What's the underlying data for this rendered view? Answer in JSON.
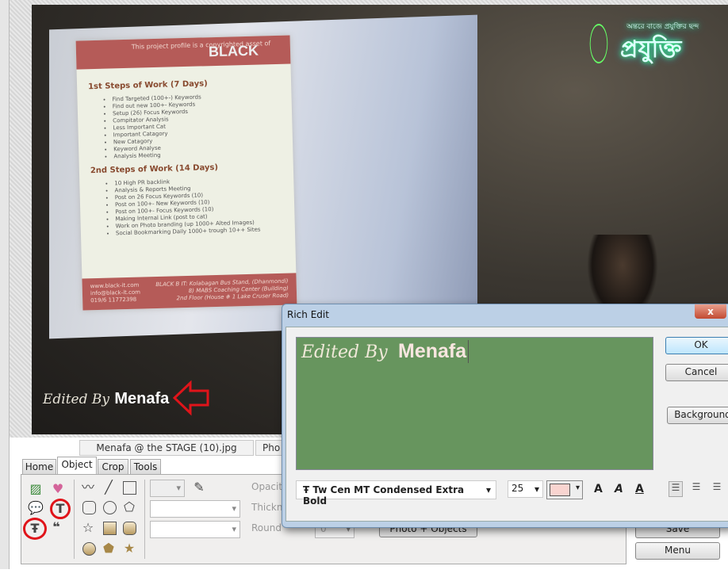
{
  "photo": {
    "slide_header": "This project profile is a copyrighted asset of",
    "slide_brand": "BLACK",
    "section1_title": "1st Steps of Work (7 Days)",
    "section1_items": [
      "Find Targeted (100+-) Keywords",
      "Find out new 100+- Keywords",
      "Setup (26) Focus Keywords",
      "Compitator Analysis",
      "Less Important Cat",
      "Important Catagory",
      "New Catagory",
      "Keyword Analyse",
      "Analysis Meeting"
    ],
    "section2_title": "2nd Steps of Work (14 Days)",
    "section2_items": [
      "10 High PR backlink",
      "Analysis & Reports Meeting",
      "Post on 26 Focus Keywords (10)",
      "Post on 100+- New Keywords (10)",
      "Post on 100+- Focus Keywords (10)",
      "Making Internal Link (post to cat)",
      "Work on Photo branding (up 1000+ Alted Images)",
      "Social Bookmarking Daily 1000+ trough 10++ Sites"
    ],
    "footer_left": [
      "www.black-it.com",
      "info@black-it.com",
      "019/6 11772398"
    ],
    "footer_right": [
      "BLACK B IT: Kolabagan Bus Stand, (Dhanmondi)",
      "8) MABS Coaching Center (Building)",
      "2nd Floor (House # 1 Lake Cruser Road)"
    ],
    "logo_text": "প্রযুক্তি",
    "logo_tagline": "অন্তরে বাজে প্রযুক্তির ছন্দ",
    "caption_script": "Edited By",
    "caption_bold": "Menafa"
  },
  "file_tabs": [
    "Menafa @ the STAGE (10).jpg",
    "Pho"
  ],
  "tabs": [
    {
      "label": "Home"
    },
    {
      "label": "Object",
      "active": true
    },
    {
      "label": "Crop"
    },
    {
      "label": "Tools"
    }
  ],
  "object_panel": {
    "opacity_label": "Opacit",
    "thickness_label": "Thickn",
    "round_label": "Round",
    "round_value": "0",
    "photo_objects_button": "Photo + Objects"
  },
  "side_buttons": {
    "save": "Save",
    "menu": "Menu"
  },
  "dialog": {
    "title": "Rich Edit",
    "close": "x",
    "ok": "OK",
    "cancel": "Cancel",
    "background": "Background",
    "text_script": "Edited By",
    "text_bold": "Menafa",
    "font": "Tw Cen MT Condensed Extra Bold",
    "size": "25",
    "text_color": "#f9d4d0",
    "background_color": "#67955e",
    "bold": "A",
    "italic": "A",
    "underline": "A"
  },
  "colors": {
    "highlight_circle": "#e0141a",
    "arrow": "#e0141a"
  }
}
